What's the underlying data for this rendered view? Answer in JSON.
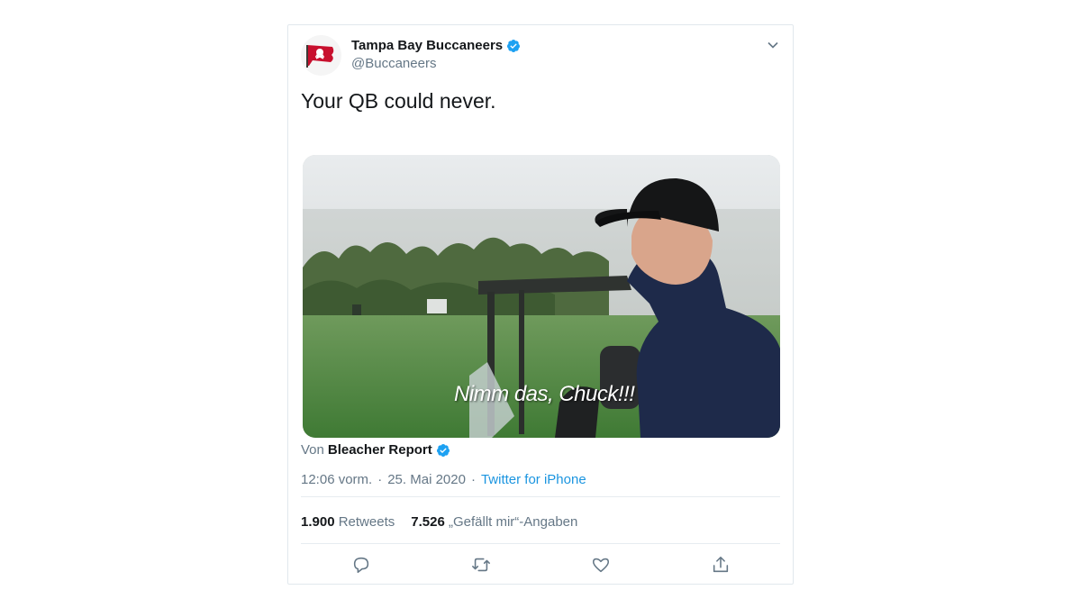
{
  "tweet": {
    "author_name": "Tampa Bay Buccaneers",
    "author_handle": "@Buccaneers",
    "text": "Your QB could never.",
    "video_subtitle": "Nimm das, Chuck!!!",
    "source_prefix": "Von",
    "source_name": "Bleacher Report",
    "time": "12:06 vorm.",
    "separator": "·",
    "date": "25. Mai 2020",
    "app": "Twitter for iPhone",
    "retweets_count": "1.900",
    "retweets_label": "Retweets",
    "likes_count": "7.526",
    "likes_label": "„Gefällt mir“-Angaben"
  },
  "icons": {
    "verified": "verified-badge-icon",
    "caret": "chevron-down-icon",
    "reply": "reply-icon",
    "retweet": "retweet-icon",
    "like": "heart-icon",
    "share": "share-icon"
  },
  "colors": {
    "verified_blue": "#1da1f2",
    "link_blue": "#1b95e0",
    "text_gray": "#657786",
    "icon_gray": "#657786"
  }
}
